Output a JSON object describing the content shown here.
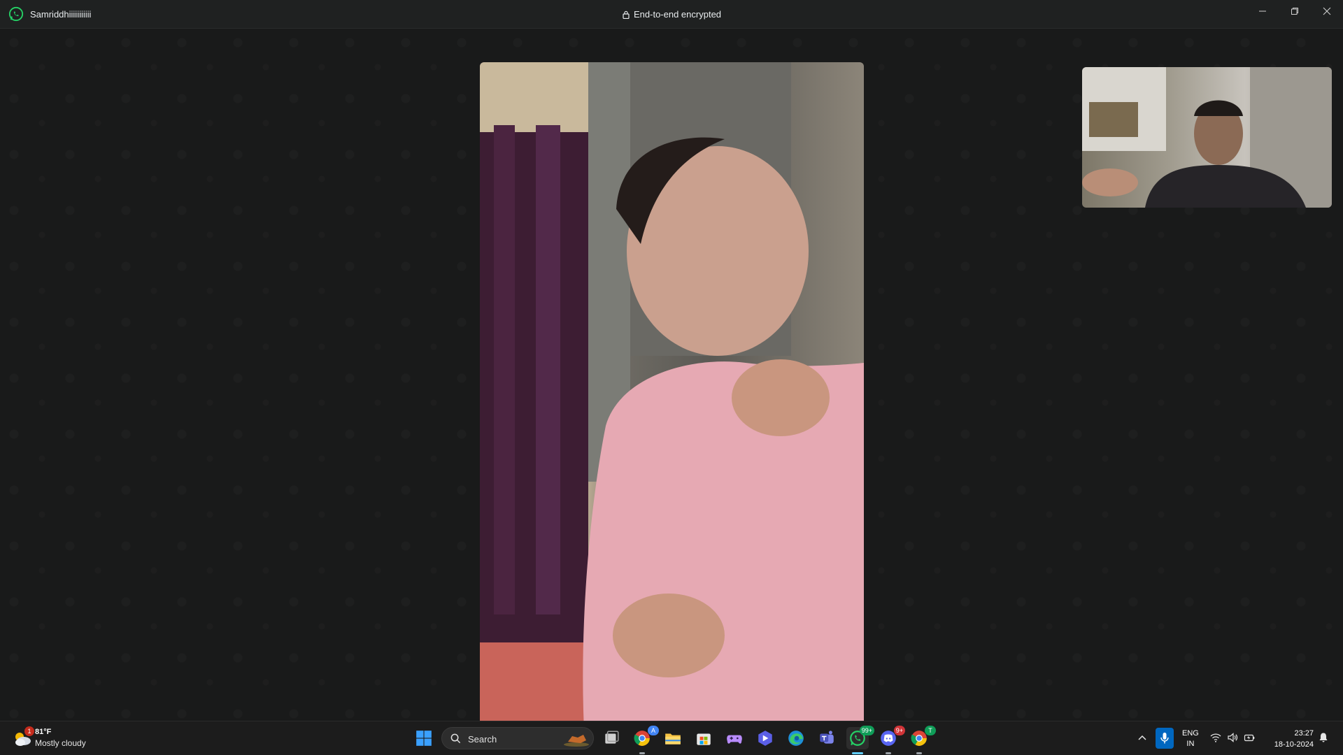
{
  "window": {
    "contact_name": "Samriddhiiiiiiiiiii",
    "encryption_label": "End-to-end encrypted",
    "icons": [
      "whatsapp-icon",
      "lock-icon",
      "minimize-icon",
      "maximize-icon",
      "close-icon"
    ]
  },
  "call": {
    "remote_video": "remote-participant-video",
    "self_video": "self-preview-video"
  },
  "taskbar": {
    "weather": {
      "temp": "81°F",
      "desc": "Mostly cloudy",
      "badge": "1"
    },
    "search_placeholder": "Search",
    "apps": [
      {
        "name": "start",
        "icon": "windows-start-icon"
      },
      {
        "name": "task-view",
        "icon": "task-view-icon"
      },
      {
        "name": "chrome",
        "icon": "chrome-icon",
        "badge": "A"
      },
      {
        "name": "file-explorer",
        "icon": "folder-icon"
      },
      {
        "name": "store",
        "icon": "store-icon"
      },
      {
        "name": "game",
        "icon": "gamepad-icon"
      },
      {
        "name": "app",
        "icon": "app-icon"
      },
      {
        "name": "edge",
        "icon": "edge-icon"
      },
      {
        "name": "teams",
        "icon": "teams-icon"
      },
      {
        "name": "whatsapp",
        "icon": "whatsapp-icon",
        "badge": "99+"
      },
      {
        "name": "discord",
        "icon": "discord-icon",
        "badge": "9+"
      },
      {
        "name": "chrome-profile",
        "icon": "chrome-icon",
        "badge": "T"
      }
    ],
    "tray": {
      "lang_line1": "ENG",
      "lang_line2": "IN",
      "time": "23:27",
      "date": "18-10-2024"
    }
  },
  "colors": {
    "accent": "#25d366",
    "titlebar": "#1f2121",
    "background": "#1a1b1b",
    "taskbar": "#1c1c1c"
  }
}
